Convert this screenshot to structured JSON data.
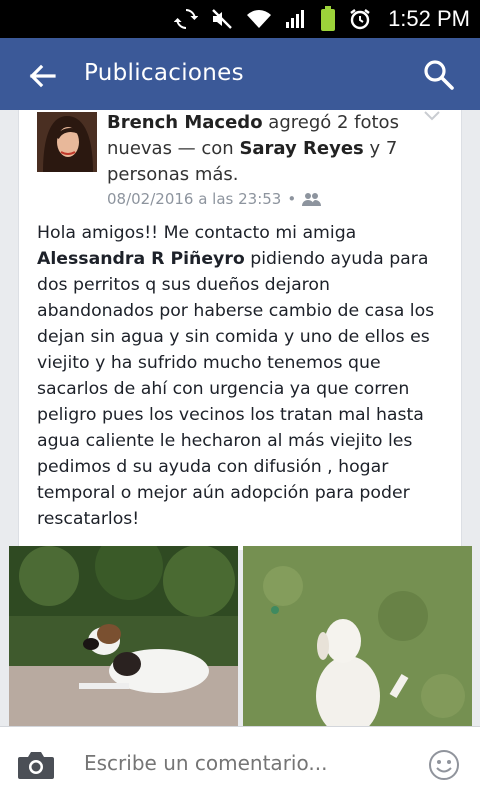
{
  "status_bar": {
    "time": "1:52 PM"
  },
  "app_bar": {
    "title": "Publicaciones"
  },
  "post": {
    "author": "Brench Macedo",
    "action_1": " agregó 2 fotos nuevas — con ",
    "tagged": "Saray Reyes",
    "action_2": " y 7 personas más.",
    "timestamp": "08/02/2016 a las 23:53",
    "body_1": "Hola amigos!! Me contacto mi amiga ",
    "mention": "Alessandra R Piñeyro",
    "body_2": " pidiendo ayuda para dos perritos q sus dueños dejaron abandonados por haberse cambio de casa los dejan sin agua y sin comida y uno de ellos es viejito y ha sufrido mucho tenemos que sacarlos de ahí con urgencia ya que corren peligro pues los vecinos los tratan mal hasta agua caliente le hecharon al más viejito les pedimos d su ayuda con difusión , hogar temporal o mejor aún adopción para poder rescatarlos!"
  },
  "comment_bar": {
    "placeholder": "Escribe un comentario..."
  },
  "colors": {
    "header_blue": "#3b5998",
    "meta_gray": "#8d949e"
  }
}
